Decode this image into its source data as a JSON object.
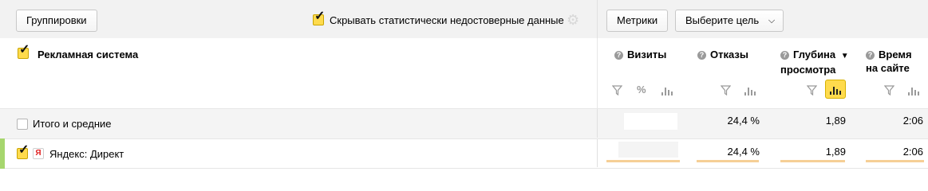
{
  "toolbar": {
    "groupings_label": "Группировки",
    "hide_unreliable_label": "Скрывать статистически недостоверные данные",
    "hide_unreliable_checked": true,
    "metrics_label": "Метрики",
    "goal_select_label": "Выберите цель"
  },
  "table": {
    "dimension_header": "Рекламная система",
    "columns": [
      {
        "label_line1": "Визиты",
        "label_line2": ""
      },
      {
        "label_line1": "Отказы",
        "label_line2": ""
      },
      {
        "label_line1": "Глубина",
        "label_line2": "просмотра",
        "sorted": "desc"
      },
      {
        "label_line1": "Время",
        "label_line2": "на сайте"
      }
    ],
    "tool_icons": {
      "percent": "%"
    },
    "rows": [
      {
        "label": "Итого и средние",
        "checked": false,
        "visits": "",
        "bounce": "24,4 %",
        "depth": "1,89",
        "time": "2:06"
      },
      {
        "label": "Яндекс: Директ",
        "checked": true,
        "visits": "",
        "bounce": "24,4 %",
        "depth": "1,89",
        "time": "2:06",
        "badge": "Я"
      }
    ]
  },
  "colors": {
    "accent": "#ffdb4d",
    "row_marker": "#a6d66e",
    "bar_underline": "#f6cf96"
  }
}
